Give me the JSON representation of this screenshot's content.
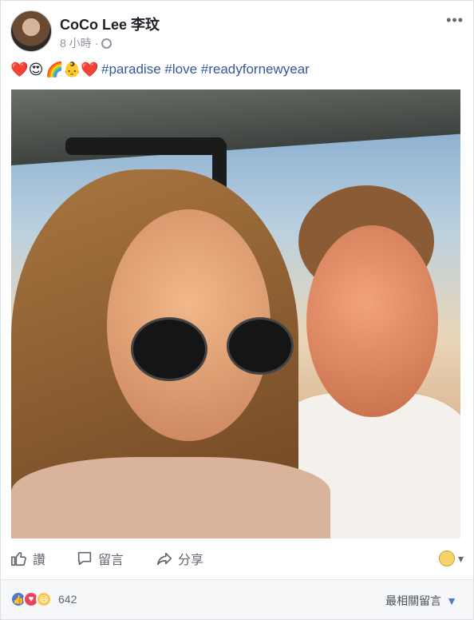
{
  "post": {
    "author": "CoCo Lee 李玟",
    "time": "8 小時",
    "more": "•••",
    "caption_emojis": [
      "❤️",
      "😍",
      "🌈",
      "👶",
      "❤️"
    ],
    "caption_tags": "#paradise #love #readyfornewyear"
  },
  "actions": {
    "like_label": "讚",
    "comment_label": "留言",
    "share_label": "分享"
  },
  "footer": {
    "reaction_count": "642",
    "sort_label": "最相關留言"
  },
  "icons": {
    "globe": "globe-icon",
    "like": "thumbs-up-icon",
    "comment": "comment-bubble-icon",
    "share": "share-arrow-icon"
  },
  "colors": {
    "link": "#365899",
    "like_blue": "#4b79cf",
    "love_red": "#e9445a",
    "haha_yellow": "#f7c94b"
  }
}
